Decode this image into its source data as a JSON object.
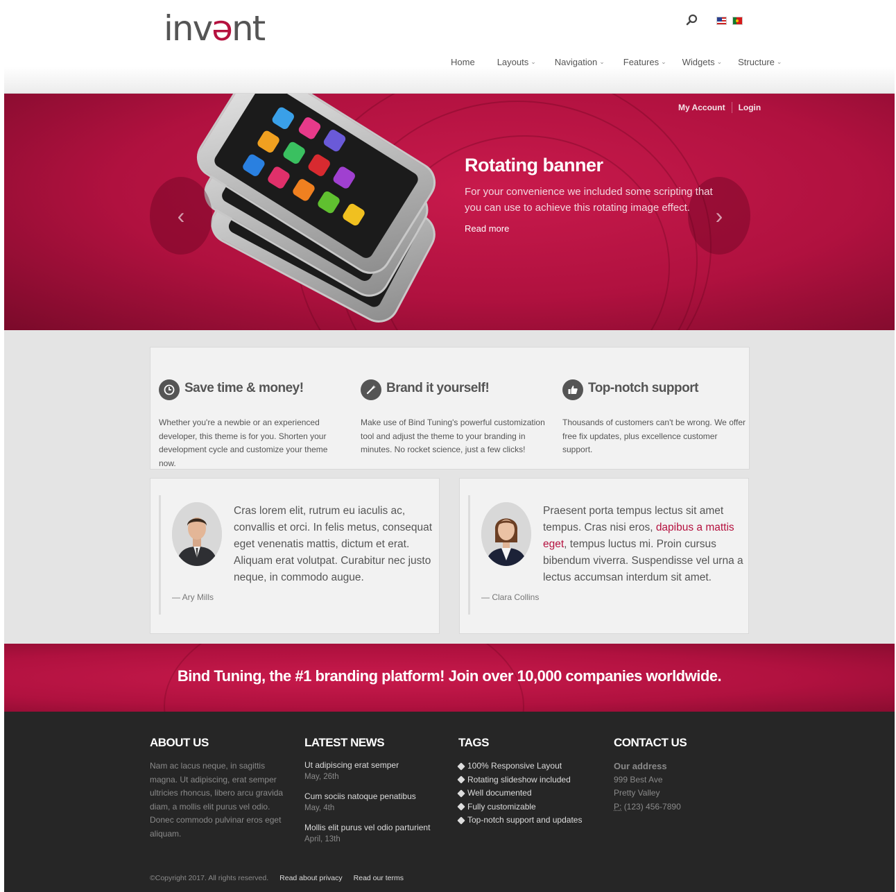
{
  "header": {
    "logo_pre": "inv",
    "logo_accent": "ə",
    "logo_post": "nt",
    "nav": [
      {
        "label": "Home",
        "has_dropdown": false
      },
      {
        "label": "Layouts",
        "has_dropdown": true
      },
      {
        "label": "Navigation",
        "has_dropdown": true
      },
      {
        "label": "Features",
        "has_dropdown": true
      },
      {
        "label": "Widgets",
        "has_dropdown": true
      },
      {
        "label": "Structure",
        "has_dropdown": true
      }
    ]
  },
  "banner": {
    "my_account": "My Account",
    "login": "Login",
    "title": "Rotating banner",
    "text": "For your convenience we included some scripting that you can use to achieve this rotating image effect.",
    "read_more": "Read more",
    "prev_glyph": "‹",
    "next_glyph": "›"
  },
  "features": [
    {
      "icon": "clock-icon",
      "title": "Save time & money!",
      "text": "Whether you're a newbie or an experienced developer, this theme is for you. Shorten your development cycle and customize your theme now."
    },
    {
      "icon": "magic-wand-icon",
      "title": "Brand it yourself!",
      "text": "Make use of Bind Tuning's powerful customization tool and adjust the theme to your branding in minutes. No rocket science, just a few clicks!"
    },
    {
      "icon": "thumbs-up-icon",
      "title": "Top-notch support",
      "text": "Thousands of customers can't be wrong. We offer free fix updates, plus excellence customer support."
    }
  ],
  "testimonials": [
    {
      "quote_before": "Cras lorem elit, rutrum eu iaculis ac, convallis et orci. In felis metus, consequat eget venenatis mattis, dictum et erat. Aliquam erat volutpat. Curabitur nec justo neque, in commodo augue.",
      "quote_link": "",
      "quote_after": "",
      "author": "— Ary Mills"
    },
    {
      "quote_before": "Praesent porta tempus lectus sit amet tempus. Cras nisi eros, ",
      "quote_link": "dapibus a mattis eget",
      "quote_after": ", tempus luctus mi. Proin cursus bibendum viverra. Suspendisse vel urna a lectus accumsan interdum sit amet.",
      "author": "— Clara Collins"
    }
  ],
  "cta": {
    "text": "Bind Tuning, the #1 branding platform! Join over 10,000 companies worldwide."
  },
  "footer": {
    "about": {
      "title": "ABOUT US",
      "text": "Nam ac lacus neque, in sagittis magna. Ut adipiscing, erat semper ultricies rhoncus, libero arcu gravida diam, a mollis elit purus vel odio. Donec commodo pulvinar eros eget aliquam."
    },
    "news": {
      "title": "LATEST NEWS",
      "items": [
        {
          "title": "Ut adipiscing erat semper",
          "date": "May, 26th"
        },
        {
          "title": "Cum sociis natoque penatibus",
          "date": "May, 4th"
        },
        {
          "title": "Mollis elit purus vel odio parturient",
          "date": "April, 13th"
        }
      ]
    },
    "tags": {
      "title": "TAGS",
      "items": [
        "100% Responsive Layout",
        "Rotating slideshow included",
        "Well documented",
        "Fully customizable",
        "Top-notch support and updates"
      ]
    },
    "contact": {
      "title": "CONTACT US",
      "label": "Our address",
      "street": "999 Best Ave",
      "city": "Pretty Valley",
      "phone_label": "P:",
      "phone": "(123) 456-7890"
    },
    "copyright": "©Copyright 2017. All rights reserved.",
    "privacy": "Read about privacy",
    "terms": "Read our terms"
  }
}
